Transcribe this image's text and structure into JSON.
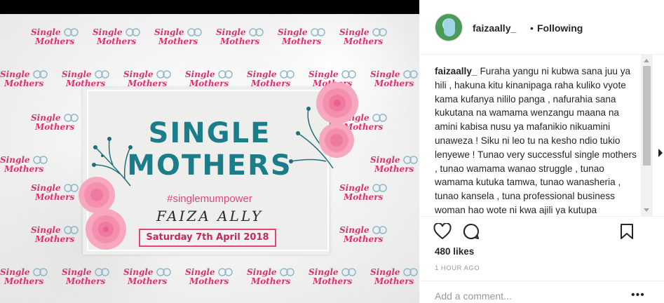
{
  "post_image": {
    "logo_word1": "Single",
    "logo_word2": "Mothers",
    "title_line1": "SINGLE",
    "title_line2": "MOTHERS",
    "hashtag": "#singlemumpower",
    "name": "FAIZA ALLY",
    "date": "Saturday 7th April 2018"
  },
  "header": {
    "username": "faizaally_",
    "separator": "•",
    "follow_status": "Following",
    "avatar_icon": "profile-avatar"
  },
  "caption": {
    "username": "faizaally_",
    "text": "Furaha yangu ni kubwa sana juu ya hili , hakuna kitu kinanipaga raha kuliko vyote kama kufanya nililo panga , nafurahia sana kukutana na wamama wenzangu maana na amini kabisa nusu ya mafanikio nikuamini unaweza ! Siku ni leo tu na kesho ndio tukio lenyewe ! Tunao very successful single mothers , tunao wamama wanao struggle , tunao wamama kutuka tamwa, tunao wanasheria , tunao kansela , tuna professional business woman hao wote ni kwa ajili ya kutupa miongozo ya kujua haki"
  },
  "actions": {
    "like_icon": "heart-icon",
    "comment_icon": "comment-icon",
    "save_icon": "bookmark-icon"
  },
  "likes": "480 likes",
  "time_ago": "1 HOUR AGO",
  "comment": {
    "placeholder": "Add a comment...",
    "more_label": "•••"
  },
  "colors": {
    "brand_pink": "#e0306e",
    "title_teal": "#1c7d8a",
    "text_dark": "#262626",
    "muted": "#999999"
  }
}
